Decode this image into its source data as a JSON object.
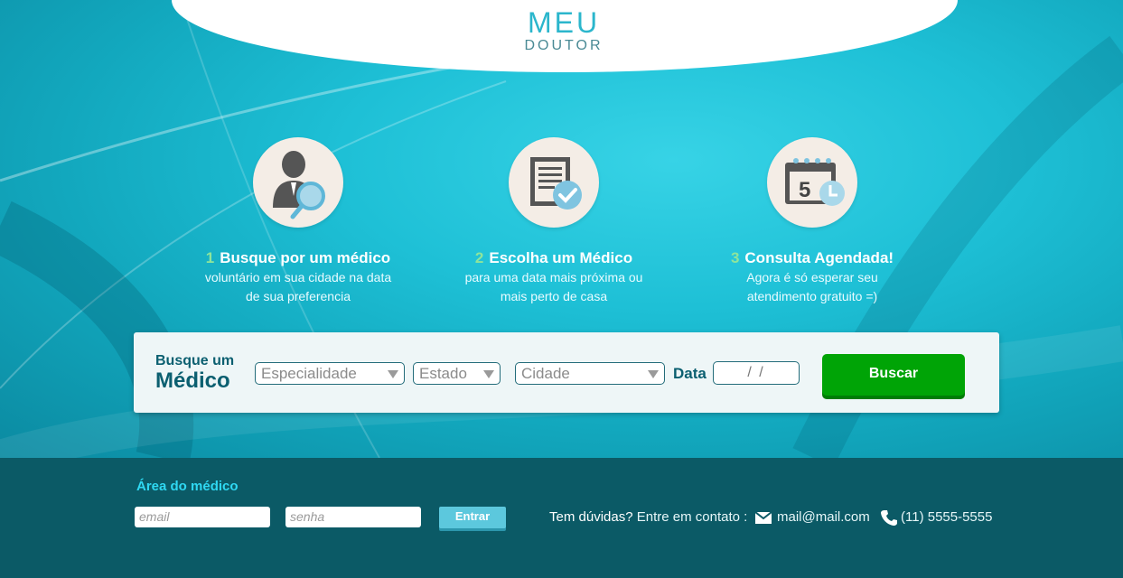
{
  "brand": {
    "line1": "MEU",
    "line2": "DOUTOR"
  },
  "steps": [
    {
      "num": "1",
      "title": "Busque por um médico",
      "desc1": "voluntário em sua cidade na data",
      "desc2": "de sua preferencia"
    },
    {
      "num": "2",
      "title": "Escolha um Médico",
      "desc1": "para uma data mais próxima ou",
      "desc2": "mais perto de casa"
    },
    {
      "num": "3",
      "title": "Consulta Agendada!",
      "desc1": "Agora é só esperar seu",
      "desc2": "atendimento gratuito =)"
    }
  ],
  "search": {
    "label_line1": "Busque um",
    "label_line2": "Médico",
    "especialidade": "Especialidade",
    "estado": "Estado",
    "cidade": "Cidade",
    "data_label": "Data",
    "date_value": "/   /",
    "button": "Buscar"
  },
  "footer": {
    "area_title": "Área do médico",
    "email_placeholder": "email",
    "senha_placeholder": "senha",
    "enter_button": "Entrar",
    "question": "Tem dúvidas?",
    "contact_text": " Entre em contato :",
    "mail": "mail@mail.com",
    "phone": "(11) 5555-5555"
  },
  "calendar_day": "5",
  "colors": {
    "accent": "#1ec0d6",
    "footer": "#0b5a66",
    "button": "#00a406",
    "step_num": "#8ee59b"
  }
}
